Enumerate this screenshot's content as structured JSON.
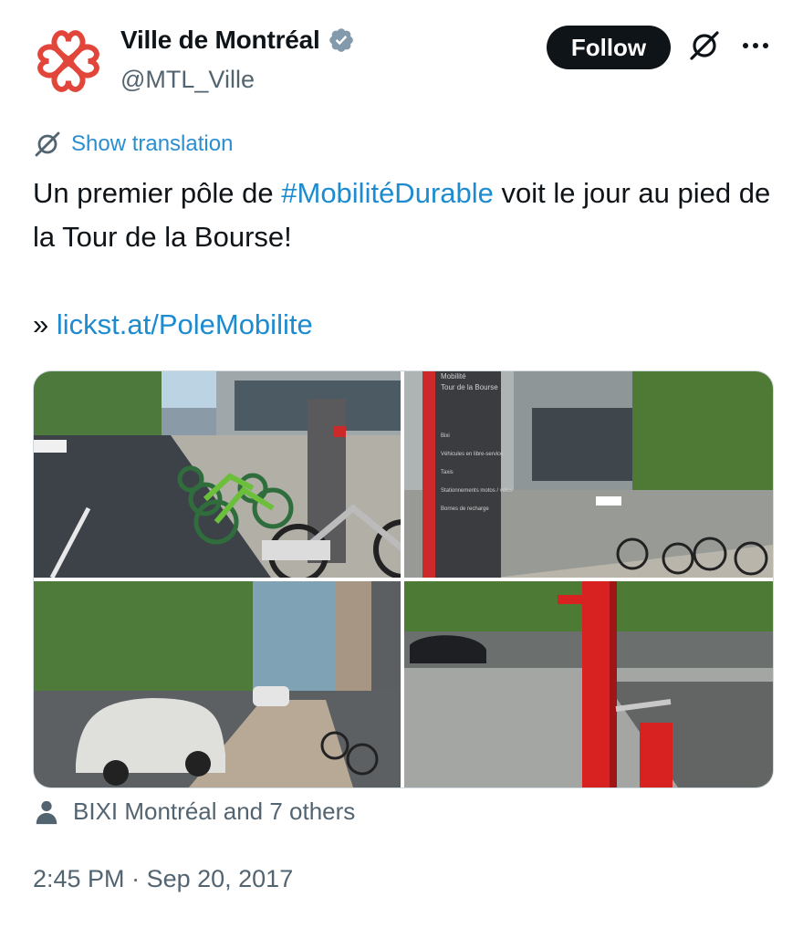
{
  "account": {
    "display_name": "Ville de Montréal",
    "handle": "@MTL_Ville",
    "verified_color": "#829aab",
    "logo_color": "#e2453a"
  },
  "actions": {
    "follow_label": "Follow"
  },
  "tweet": {
    "translate_label": "Show translation",
    "text_before_hashtag": "Un premier pôle de ",
    "hashtag": "#MobilitéDurable",
    "text_after_hashtag": " voit le jour au pied de la Tour de la Bourse!",
    "link_prefix": "» ",
    "link_text": "lickst.at/PoleMobilite",
    "link_color": "#1d8bd0"
  },
  "media": {
    "photos": [
      {
        "subject": "bixi-bike-dock"
      },
      {
        "subject": "mobility-hub-sign"
      },
      {
        "subject": "electric-car-charging"
      },
      {
        "subject": "bike-repair-station"
      }
    ],
    "sign_text": {
      "title_line1": "Mobilité",
      "title_line2": "Tour de la Bourse",
      "items": [
        "Bixi",
        "Véhicules en libre-service",
        "Taxis",
        "Stationnements motos / vélos",
        "Bornes de recharge"
      ]
    }
  },
  "tagged": {
    "text": "BIXI Montréal and 7 others"
  },
  "meta": {
    "time": "2:45 PM",
    "separator": " · ",
    "date": "Sep 20, 2017"
  }
}
